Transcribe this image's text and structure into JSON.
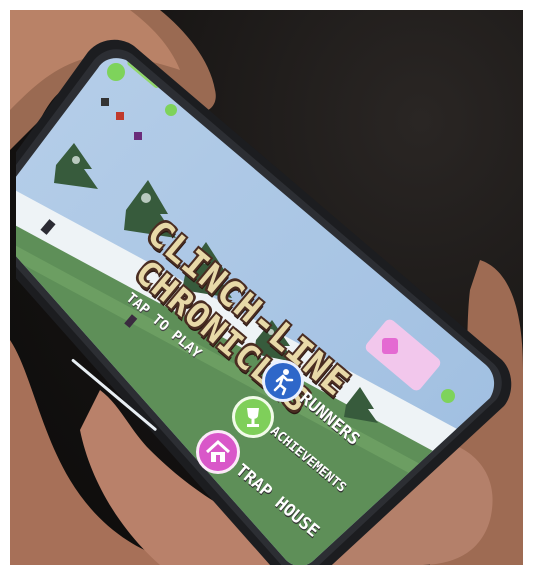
{
  "game": {
    "title_line1": "CLINCH-LINE",
    "title_line2": "CHRONICLES",
    "tap_to_play": "TAP TO PLAY"
  },
  "menu": {
    "runners": "RUNNERS",
    "achievements": "ACHIEVEMENTS",
    "trap_house": "TRAP HOUSE"
  },
  "icons": {
    "runners": "running-person-icon",
    "achievements": "trophy-icon",
    "trap_house": "house-icon",
    "currency": "coin-icon",
    "shop": "cup-icon"
  },
  "colors": {
    "sky": "#a9c6e6",
    "grass": "#5f8f57",
    "runners_button": "#2e67c9",
    "achievements_button": "#7fcf5a",
    "trap_house_button": "#d957c9",
    "title_fill": "#e8d9a8",
    "title_outline": "#4a2d22"
  }
}
